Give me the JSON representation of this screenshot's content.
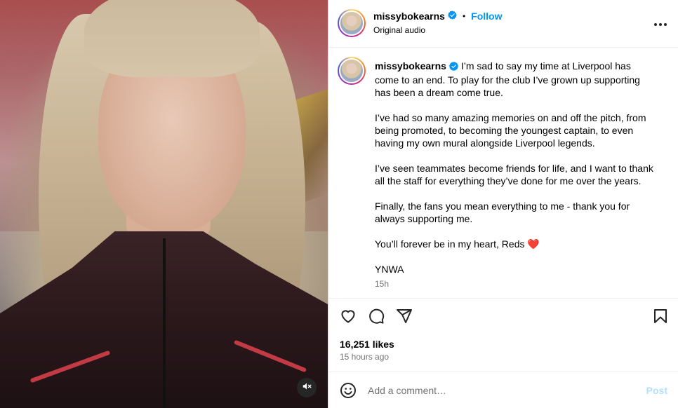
{
  "post": {
    "username": "missybokearns",
    "verified": true,
    "follow_label": "Follow",
    "separator": "•",
    "audio_label": "Original audio",
    "more_icon": "more-horizontal-icon"
  },
  "caption": {
    "username": "missybokearns",
    "paragraphs": [
      "I’m sad to say my time at Liverpool has come to an end. To play for the club I’ve grown up supporting has been a dream come true.",
      "I’ve had so many amazing memories on and off the pitch, from being promoted, to becoming the youngest captain, to even having my own mural alongside Liverpool legends.",
      "I’ve seen teammates become friends for life, and I want to thank all the staff for everything they’ve done for me over the years.",
      "Finally, the fans you mean everything to me - thank you for always supporting me.",
      "You’ll forever be in my heart, Reds ❤️",
      "YNWA"
    ],
    "time": "15h"
  },
  "actions": {
    "like_icon": "heart-icon",
    "comment_icon": "comment-icon",
    "share_icon": "send-icon",
    "save_icon": "bookmark-icon"
  },
  "stats": {
    "likes": "16,251 likes",
    "time_ago": "15 hours ago"
  },
  "comment_bar": {
    "emoji_icon": "emoji-icon",
    "placeholder": "Add a comment…",
    "post_label": "Post"
  },
  "media": {
    "mute_icon": "muted-speaker-icon"
  },
  "colors": {
    "accent": "#0095f6",
    "post_disabled": "#b2dffc",
    "secondary_text": "#737373",
    "verified": "#0095f6"
  }
}
